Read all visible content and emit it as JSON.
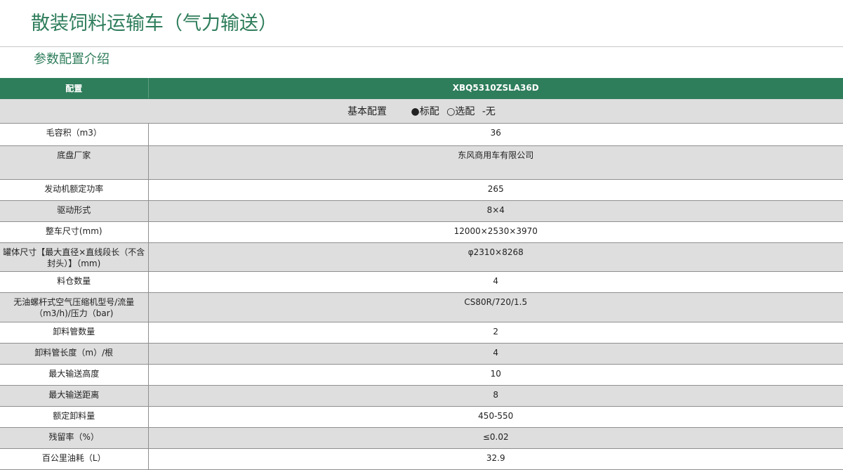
{
  "page": {
    "title": "散装饲料运输车（气力输送）",
    "section_title": "参数配置介绍"
  },
  "table": {
    "header": {
      "label": "配置",
      "model": "XBQ5310ZSLA36D"
    },
    "legend": {
      "basic": "基本配置",
      "standard": "●标配",
      "optional": "○选配",
      "none": "-无"
    },
    "rows": [
      {
        "label": "毛容积（m3）",
        "value": "36"
      },
      {
        "label": "底盘厂家",
        "value": "东风商用车有限公司"
      },
      {
        "label": "发动机额定功率",
        "value": "265"
      },
      {
        "label": "驱动形式",
        "value": "8×4"
      },
      {
        "label": "整车尺寸(mm)",
        "value": "12000×2530×3970"
      },
      {
        "label": "罐体尺寸【最大直径×直线段长（不含封头）】（mm)",
        "value": "φ2310×8268"
      },
      {
        "label": "料仓数量",
        "value": "4"
      },
      {
        "label": "无油螺杆式空气压缩机型号/流量（m3/h)/压力（bar)",
        "value": "CS80R/720/1.5"
      },
      {
        "label": "卸料管数量",
        "value": "2"
      },
      {
        "label": "卸料管长度（m）/根",
        "value": "4"
      },
      {
        "label": "最大输送高度",
        "value": "10"
      },
      {
        "label": "最大输送距离",
        "value": "8"
      },
      {
        "label": "额定卸料量",
        "value": "450-550"
      },
      {
        "label": "残留率（%）",
        "value": "≤0.02"
      },
      {
        "label": "百公里油耗（L）",
        "value": "32.9"
      }
    ]
  }
}
